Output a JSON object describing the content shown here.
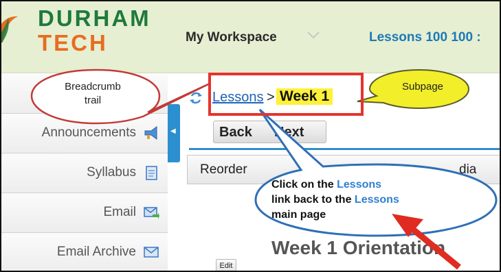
{
  "header": {
    "logo_line1": "DURHAM",
    "logo_line2": "TECH",
    "workspace_label": "My Workspace",
    "site_tab": "Lessons 100 100 :"
  },
  "sidebar": {
    "items": [
      {
        "label": "Announcements",
        "icon": "megaphone-icon"
      },
      {
        "label": "Syllabus",
        "icon": "document-icon"
      },
      {
        "label": "Email",
        "icon": "email-send-icon"
      },
      {
        "label": "Email Archive",
        "icon": "envelope-icon"
      }
    ]
  },
  "breadcrumb": {
    "link": "Lessons",
    "separator": ">",
    "current": "Week 1"
  },
  "nav": {
    "back": "Back",
    "next": "Next"
  },
  "toolbar": {
    "reorder": "Reorder",
    "media": "dia"
  },
  "page_heading": "Week 1 Orientation",
  "edit_button": "Edit",
  "callouts": {
    "breadcrumb_line1": "Breadcrumb",
    "breadcrumb_line2": "trail",
    "subpage": "Subpage",
    "instruction_part1": "Click on the ",
    "instruction_link1": "Lessons",
    "instruction_part2": "link back to the ",
    "instruction_link2": "Lessons",
    "instruction_part3": "main page"
  },
  "colors": {
    "header_bg": "#e6efd2",
    "logo_green": "#1e7a3c",
    "logo_orange": "#e86c1f",
    "link_blue": "#1d63b8",
    "highlight_yellow": "#fff03a",
    "annotation_red": "#e4342e",
    "accent_blue": "#2c8fcf"
  }
}
